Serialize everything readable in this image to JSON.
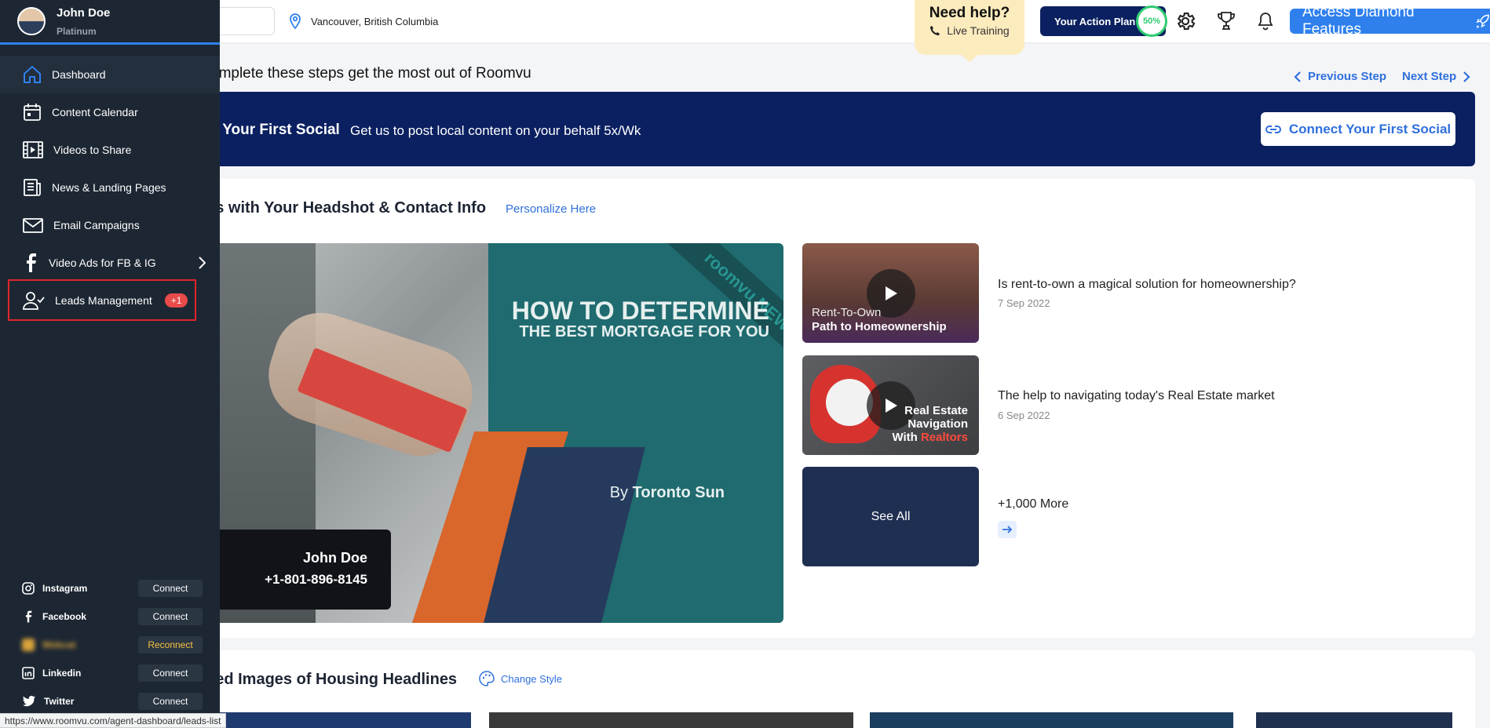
{
  "header": {
    "location": "Vancouver, British Columbia",
    "help_title": "Need help?",
    "help_sub": "Live Training",
    "action_plan_label": "Your Action Plan",
    "action_plan_progress": "50%",
    "diamond_label": "Access Diamond Features"
  },
  "steps": {
    "title": "omplete these steps get the most out of Roomvu",
    "prev": "Previous Step",
    "next": "Next Step",
    "banner_title": "t Your First Social",
    "banner_desc": "Get us to post local content on your behalf 5x/Wk",
    "banner_button": "Connect Your First Social"
  },
  "videos": {
    "section_title": "os with Your Headshot & Contact Info",
    "personalize": "Personalize Here",
    "hero": {
      "headline1": "HOW TO DETERMINE",
      "headline2": "THE BEST MORTGAGE FOR YOU",
      "ribbon": "roomvu  NEW",
      "by_prefix": "By",
      "by_source": "Toronto Sun",
      "contact_name": "John Doe",
      "contact_phone": "+1-801-896-8145"
    },
    "items": [
      {
        "thumb_line1": "Rent-To-Own",
        "thumb_line2": "Path to Homeownership",
        "title": "Is rent-to-own a magical solution for homeownership?",
        "date": "7 Sep 2022"
      },
      {
        "thumb_line1": "Real Estate",
        "thumb_line2": "Navigation",
        "thumb_line3a": "With",
        "thumb_line3b": "Realtors",
        "title": "The help to navigating today's Real Estate market",
        "date": "6 Sep 2022"
      }
    ],
    "see_all": "See All",
    "more": "+1,000 More"
  },
  "images_section": {
    "title": "ded Images of Housing Headlines",
    "change_style": "Change Style"
  },
  "sidebar": {
    "user_name": "John Doe",
    "tier": "Platinum",
    "items": [
      {
        "label": "Dashboard"
      },
      {
        "label": "Content Calendar"
      },
      {
        "label": "Videos to Share"
      },
      {
        "label": "News & Landing Pages"
      },
      {
        "label": "Email Campaigns"
      },
      {
        "label": "Video Ads for FB & IG"
      },
      {
        "label": "Leads Management",
        "badge": "+1"
      }
    ],
    "socials": [
      {
        "label": "Instagram",
        "action": "Connect"
      },
      {
        "label": "Facebook",
        "action": "Connect"
      },
      {
        "label": "Webcat",
        "action": "Reconnect"
      },
      {
        "label": "Linkedin",
        "action": "Connect"
      },
      {
        "label": "Twitter",
        "action": "Connect"
      }
    ]
  },
  "status_url": "https://www.roomvu.com/agent-dashboard/leads-list",
  "colors": {
    "sidebar_bg": "#1d2733",
    "brand_navy": "#0b2060",
    "accent_blue": "#2f80ed",
    "highlight_red": "#e0262a",
    "progress_green": "#2fcc71"
  }
}
